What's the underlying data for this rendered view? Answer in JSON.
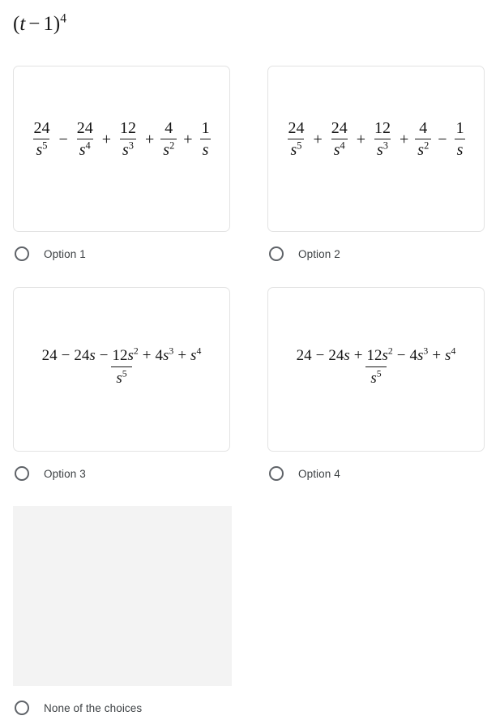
{
  "question": {
    "prompt_plain": "(t - 1)^4",
    "open_paren": "(",
    "var": "t",
    "minus": "−",
    "one": "1",
    "close_paren": ")",
    "exponent": "4"
  },
  "options": [
    {
      "id": "option-1",
      "label": "Option 1",
      "expression_plain": "24/s^5 - 24/s^4 + 12/s^3 + 4/s^2 + 1/s",
      "type": "sum-of-fractions",
      "terms": [
        {
          "op": "",
          "num": "24",
          "den_base": "s",
          "den_exp": "5"
        },
        {
          "op": "−",
          "num": "24",
          "den_base": "s",
          "den_exp": "4"
        },
        {
          "op": "+",
          "num": "12",
          "den_base": "s",
          "den_exp": "3"
        },
        {
          "op": "+",
          "num": "4",
          "den_base": "s",
          "den_exp": "2"
        },
        {
          "op": "+",
          "num": "1",
          "den_base": "s",
          "den_exp": ""
        }
      ]
    },
    {
      "id": "option-2",
      "label": "Option 2",
      "expression_plain": "24/s^5 + 24/s^4 + 12/s^3 + 4/s^2 - 1/s",
      "type": "sum-of-fractions",
      "terms": [
        {
          "op": "",
          "num": "24",
          "den_base": "s",
          "den_exp": "5"
        },
        {
          "op": "+",
          "num": "24",
          "den_base": "s",
          "den_exp": "4"
        },
        {
          "op": "+",
          "num": "12",
          "den_base": "s",
          "den_exp": "3"
        },
        {
          "op": "+",
          "num": "4",
          "den_base": "s",
          "den_exp": "2"
        },
        {
          "op": "−",
          "num": "1",
          "den_base": "s",
          "den_exp": ""
        }
      ]
    },
    {
      "id": "option-3",
      "label": "Option 3",
      "expression_plain": "(24 - 24s - 12s^2 + 4s^3 + s^4) / s^5",
      "type": "single-fraction",
      "numerator": [
        {
          "op": "",
          "coef": "24",
          "var": "",
          "exp": ""
        },
        {
          "op": "−",
          "coef": "24",
          "var": "s",
          "exp": ""
        },
        {
          "op": "−",
          "coef": "12",
          "var": "s",
          "exp": "2"
        },
        {
          "op": "+",
          "coef": "4",
          "var": "s",
          "exp": "3"
        },
        {
          "op": "+",
          "coef": "",
          "var": "s",
          "exp": "4"
        }
      ],
      "denominator": {
        "base": "s",
        "exp": "5"
      }
    },
    {
      "id": "option-4",
      "label": "Option 4",
      "expression_plain": "(24 - 24s + 12s^2 - 4s^3 + s^4) / s^5",
      "type": "single-fraction",
      "numerator": [
        {
          "op": "",
          "coef": "24",
          "var": "",
          "exp": ""
        },
        {
          "op": "−",
          "coef": "24",
          "var": "s",
          "exp": ""
        },
        {
          "op": "+",
          "coef": "12",
          "var": "s",
          "exp": "2"
        },
        {
          "op": "−",
          "coef": "4",
          "var": "s",
          "exp": "3"
        },
        {
          "op": "+",
          "coef": "",
          "var": "s",
          "exp": "4"
        }
      ],
      "denominator": {
        "base": "s",
        "exp": "5"
      }
    },
    {
      "id": "option-none",
      "label": "None of the choices",
      "expression_plain": "",
      "type": "blank"
    }
  ],
  "colors": {
    "page_background": "#ffffff",
    "card_border": "#e3e3e3",
    "card_background": "#ffffff",
    "blank_card_background": "#f3f3f3",
    "radio_ring": "#5f6368",
    "label_text": "#3c4043",
    "math_text": "#141414"
  }
}
